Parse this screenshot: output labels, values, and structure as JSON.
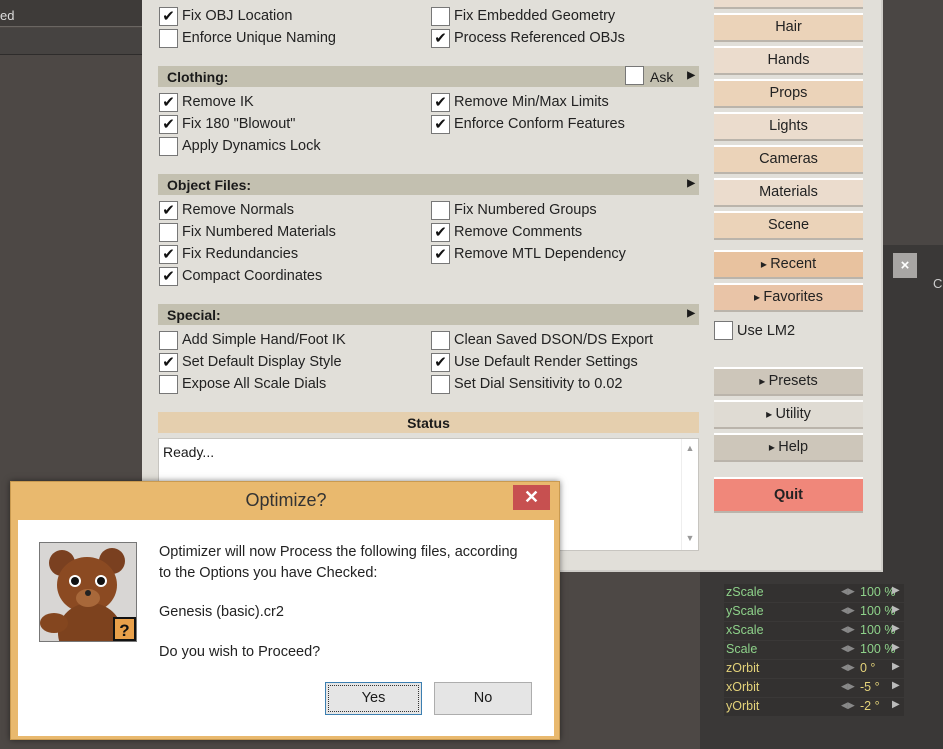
{
  "background": {
    "left_bar_text": "ed",
    "right_label": "C"
  },
  "main": {
    "top_rows": [
      {
        "label": "Fix OBJ Location",
        "checked": true
      },
      {
        "label": "Fix Embedded Geometry",
        "checked": false
      },
      {
        "label": "Enforce Unique Naming",
        "checked": false
      },
      {
        "label": "Process Referenced OBJs",
        "checked": true
      }
    ],
    "clothing": {
      "title": "Clothing:",
      "ask_label": "Ask",
      "ask_checked": false,
      "rows": [
        {
          "label": "Remove IK",
          "checked": true
        },
        {
          "label": "Remove Min/Max Limits",
          "checked": true
        },
        {
          "label": "Fix 180 \"Blowout\"",
          "checked": true
        },
        {
          "label": "Enforce Conform Features",
          "checked": true
        },
        {
          "label": "Apply Dynamics Lock",
          "checked": false
        }
      ]
    },
    "object_files": {
      "title": "Object Files:",
      "rows": [
        {
          "label": "Remove Normals",
          "checked": true
        },
        {
          "label": "Fix Numbered Groups",
          "checked": false
        },
        {
          "label": "Fix Numbered Materials",
          "checked": false
        },
        {
          "label": "Remove Comments",
          "checked": true
        },
        {
          "label": "Fix Redundancies",
          "checked": true
        },
        {
          "label": "Remove MTL Dependency",
          "checked": true
        },
        {
          "label": "Compact Coordinates",
          "checked": true
        }
      ]
    },
    "special": {
      "title": "Special:",
      "rows": [
        {
          "label": "Add Simple Hand/Foot IK",
          "checked": false
        },
        {
          "label": "Clean Saved DSON/DS Export",
          "checked": false
        },
        {
          "label": "Set Default Display Style",
          "checked": true
        },
        {
          "label": "Use Default Render Settings",
          "checked": true
        },
        {
          "label": "Expose All Scale Dials",
          "checked": false
        },
        {
          "label": "Set Dial Sensitivity to 0.02",
          "checked": false
        }
      ]
    },
    "status": {
      "title": "Status",
      "text": "Ready..."
    }
  },
  "right": {
    "categories": [
      "Hair",
      "Hands",
      "Props",
      "Lights",
      "Cameras",
      "Materials",
      "Scene"
    ],
    "recent": "Recent",
    "favorites": "Favorites",
    "use_lm2": "Use LM2",
    "use_lm2_checked": false,
    "presets": "Presets",
    "utility": "Utility",
    "help": "Help",
    "quit": "Quit"
  },
  "params": [
    {
      "name": "zScale",
      "value": "100 %"
    },
    {
      "name": "yScale",
      "value": "100 %"
    },
    {
      "name": "xScale",
      "value": "100 %"
    },
    {
      "name": "Scale",
      "value": "100 %"
    },
    {
      "name": "zOrbit",
      "value": "0 °"
    },
    {
      "name": "xOrbit",
      "value": "-5 °"
    },
    {
      "name": "yOrbit",
      "value": "-2 °"
    }
  ],
  "dialog": {
    "title": "Optimize?",
    "line1": "Optimizer will now Process the following files, according",
    "line2": "to the Options you have Checked:",
    "file": "Genesis (basic).cr2",
    "question": "Do you wish to Proceed?",
    "yes": "Yes",
    "no": "No"
  }
}
